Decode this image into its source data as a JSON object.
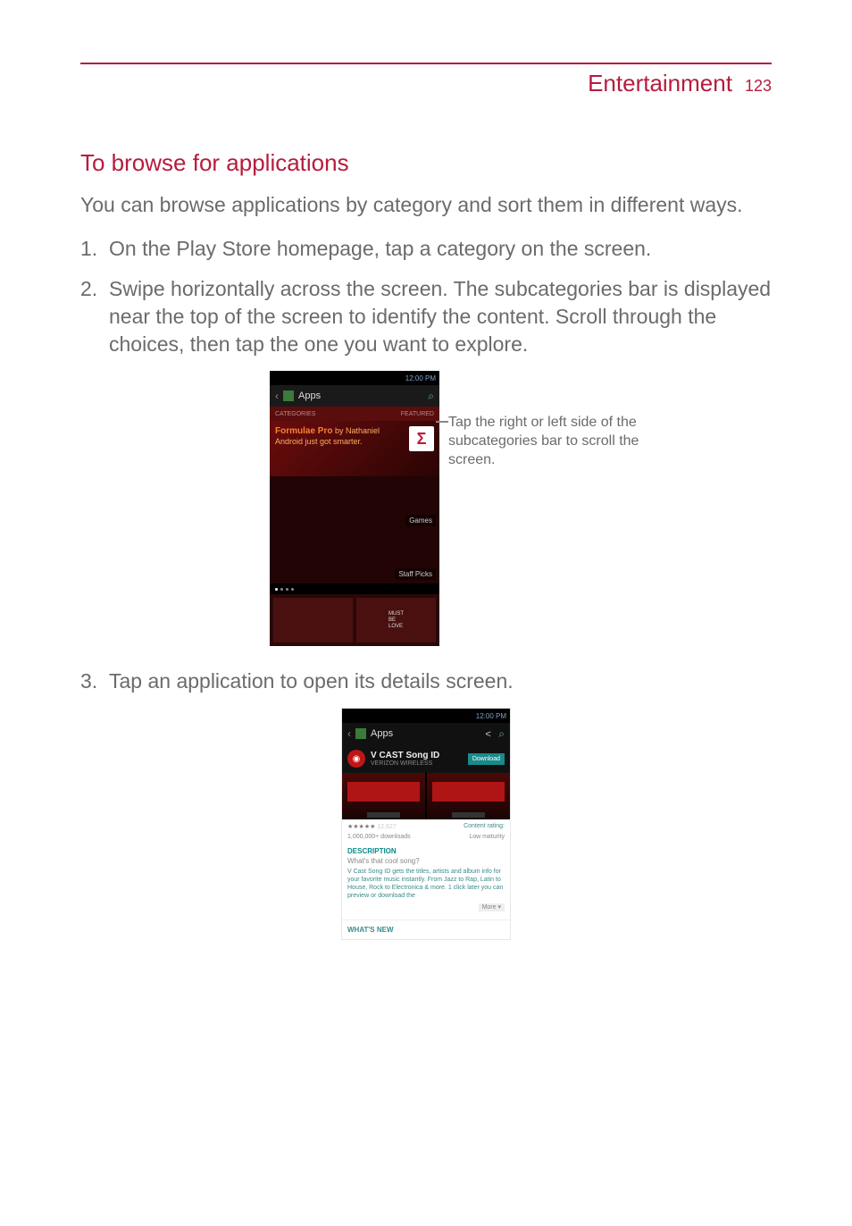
{
  "header": {
    "title": "Entertainment",
    "page": "123"
  },
  "heading": "To browse for applications",
  "intro": "You can browse applications by category and sort them in different ways.",
  "steps": {
    "s1": "On the Play Store homepage, tap a category on the screen.",
    "s2": "Swipe horizontally across the screen. The subcategories bar is displayed near the top of the screen to identify the content. Scroll through the choices, then tap the one you want to explore.",
    "s3": "Tap an application to open its details screen."
  },
  "callout": "Tap the right or left side of the subcategories bar to scroll the screen.",
  "phone_common": {
    "time": "12:00 PM"
  },
  "phone1": {
    "title": "Apps",
    "subcat_left": "CATEGORIES",
    "subcat_right": "FEATURED",
    "promo_title": "Formulae Pro",
    "promo_sub": "by Nathaniel",
    "promo_line2": "Android just got smarter.",
    "sigma": "Σ",
    "panel_games": "Games",
    "panel_staff": "Staff Picks",
    "tile_text": "MUST\nBE\nLOVE"
  },
  "phone2": {
    "back_label": "Apps",
    "app_title": "V CAST Song ID",
    "app_sub": "VERIZON WIRELESS",
    "download": "Download",
    "stars": "★★★★★",
    "rating_count": "12,627",
    "content_label": "Content rating:",
    "downloads": "1,000,000+ downloads",
    "maturity": "Low maturity",
    "desc_heading": "DESCRIPTION",
    "question": "What's that cool song?",
    "desc_body": "V Cast Song ID gets the titles, artists and album info for your favorite music instantly. From Jazz to Rap, Latin to House, Rock to Electronica & more. 1 click later you can preview or download the",
    "more": "More ▾",
    "whats_new": "WHAT'S NEW"
  }
}
